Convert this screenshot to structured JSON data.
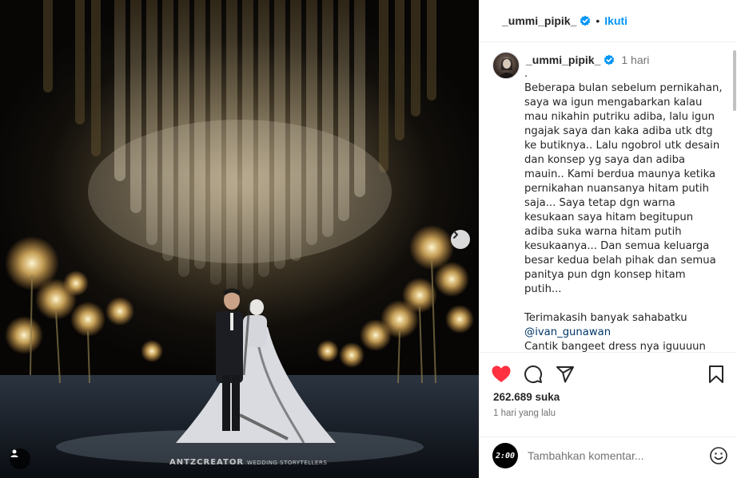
{
  "post": {
    "username": "_ummi_pipik_",
    "follow_label": "Ikuti",
    "separator": "•",
    "watermark": "ANTZCREATOR",
    "watermark_sub": "WEDDING STORYTELLERS"
  },
  "caption": {
    "username": "_ummi_pipik_",
    "time": "1 hari",
    "text_1": ".\nBeberapa bulan sebelum pernikahan, saya wa igun mengabarkan kalau mau nikahin putriku adiba, lalu igun ngajak saya dan kaka adiba utk dtg ke butiknya.. Lalu ngobrol utk desain dan konsep yg saya dan adiba mauin.. Kami berdua maunya ketika pernikahan nuansanya hitam putih saja... Saya tetap dgn warna kesukaan saya hitam begitupun adiba suka warna hitam putih kesukaanya... Dan semua keluarga besar kedua belah pihak dan semua panitya pun dgn konsep hitam putih...\n\nTerimakasih banyak sahabatku\n",
    "mention": "@ivan_gunawan",
    "text_2": "\nCantik bangeet dress nya iguuuun aku suka bangeet ❤ trimakasih igun untuk segala cintanya buat keluargaku ❤"
  },
  "stats": {
    "likes": "262.689 suka",
    "ago": "1 hari yang lalu"
  },
  "comment_box": {
    "placeholder": "Tambahkan komentar...",
    "avatar_text": "2:00"
  },
  "colors": {
    "like_red": "#ff3040",
    "link_blue": "#0095f6",
    "verified_blue": "#0095f6"
  },
  "icons": {
    "like": "heart-filled-icon",
    "comment": "comment-icon",
    "share": "share-icon",
    "save": "bookmark-icon",
    "emoji": "emoji-icon",
    "next": "chevron-right-icon",
    "tag": "user-tag-icon",
    "verified": "verified-badge-icon"
  }
}
